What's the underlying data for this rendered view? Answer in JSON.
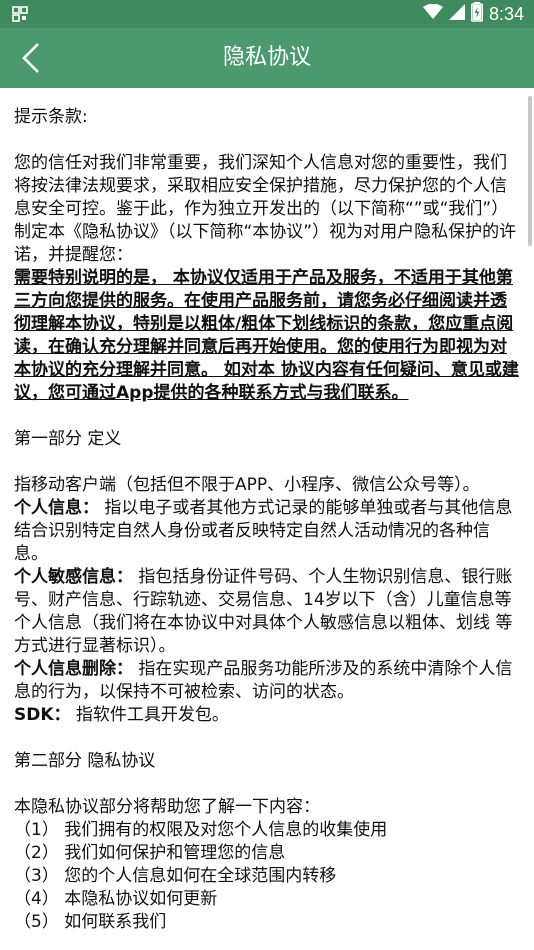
{
  "status": {
    "time": "8:34"
  },
  "app_bar": {
    "title": "隐私协议"
  },
  "doc": {
    "heading_tip": "提示条款:",
    "intro": "您的信任对我们非常重要，我们深知个人信息对您的重要性，我们将按法律法规要求，采取相应安全保护措施，尽力保护您的个人信息安全可控。鉴于此，作为独立开发出的（以下简称“”或“我们”）制定本《隐私协议》（以下简称“本协议”）视为对用户隐私保护的许诺，并提醒您：",
    "notice": "需要特别说明的是， 本协议仅适用于产品及服务，不适用于其他第三方向您提供的服务。在使用产品服务前，请您务必仔细阅读并透彻理解本协议，特别是以粗体/粗体下划线标识的条款，您应重点阅读，在确认充分理解并同意后再开始使用。您的使用行为即视为对本协议的充分理解并同意。 如对本 协议内容有任何疑问、意见或建议，您可通过App提供的各种联系方式与我们联系。",
    "part1_title": "第一部分 定义",
    "def_client": "指移动客户端（包括但不限于APP、小程序、微信公众号等）。",
    "def_personal_term": "个人信息：",
    "def_personal_text": " 指以电子或者其他方式记录的能够单独或者与其他信息结合识别特定自然人身份或者反映特定自然人活动情况的各种信息。",
    "def_sensitive_term": "个人敏感信息：",
    "def_sensitive_text": " 指包括身份证件号码、个人生物识别信息、银行账号、财产信息、行踪轨迹、交易信息、14岁以下（含）儿童信息等个人信息（我们将在本协议中对具体个人敏感信息以粗体、划线 等方式进行显著标识）。",
    "def_delete_term": "个人信息删除：",
    "def_delete_text": " 指在实现产品服务功能所涉及的系统中清除个人信息的行为，以保持不可被检索、访问的状态。",
    "def_sdk_term": "SDK：",
    "def_sdk_text": " 指软件工具开发包。",
    "part2_title": "第二部分 隐私协议",
    "part2_intro": "本隐私协议部分将帮助您了解一下内容：",
    "items": [
      "（1） 我们拥有的权限及对您个人信息的收集使用",
      "（2） 我们如何保护和管理您的信息",
      "（3） 您的个人信息如何在全球范围内转移",
      "（4） 本隐私协议如何更新",
      "（5） 如何联系我们"
    ]
  }
}
